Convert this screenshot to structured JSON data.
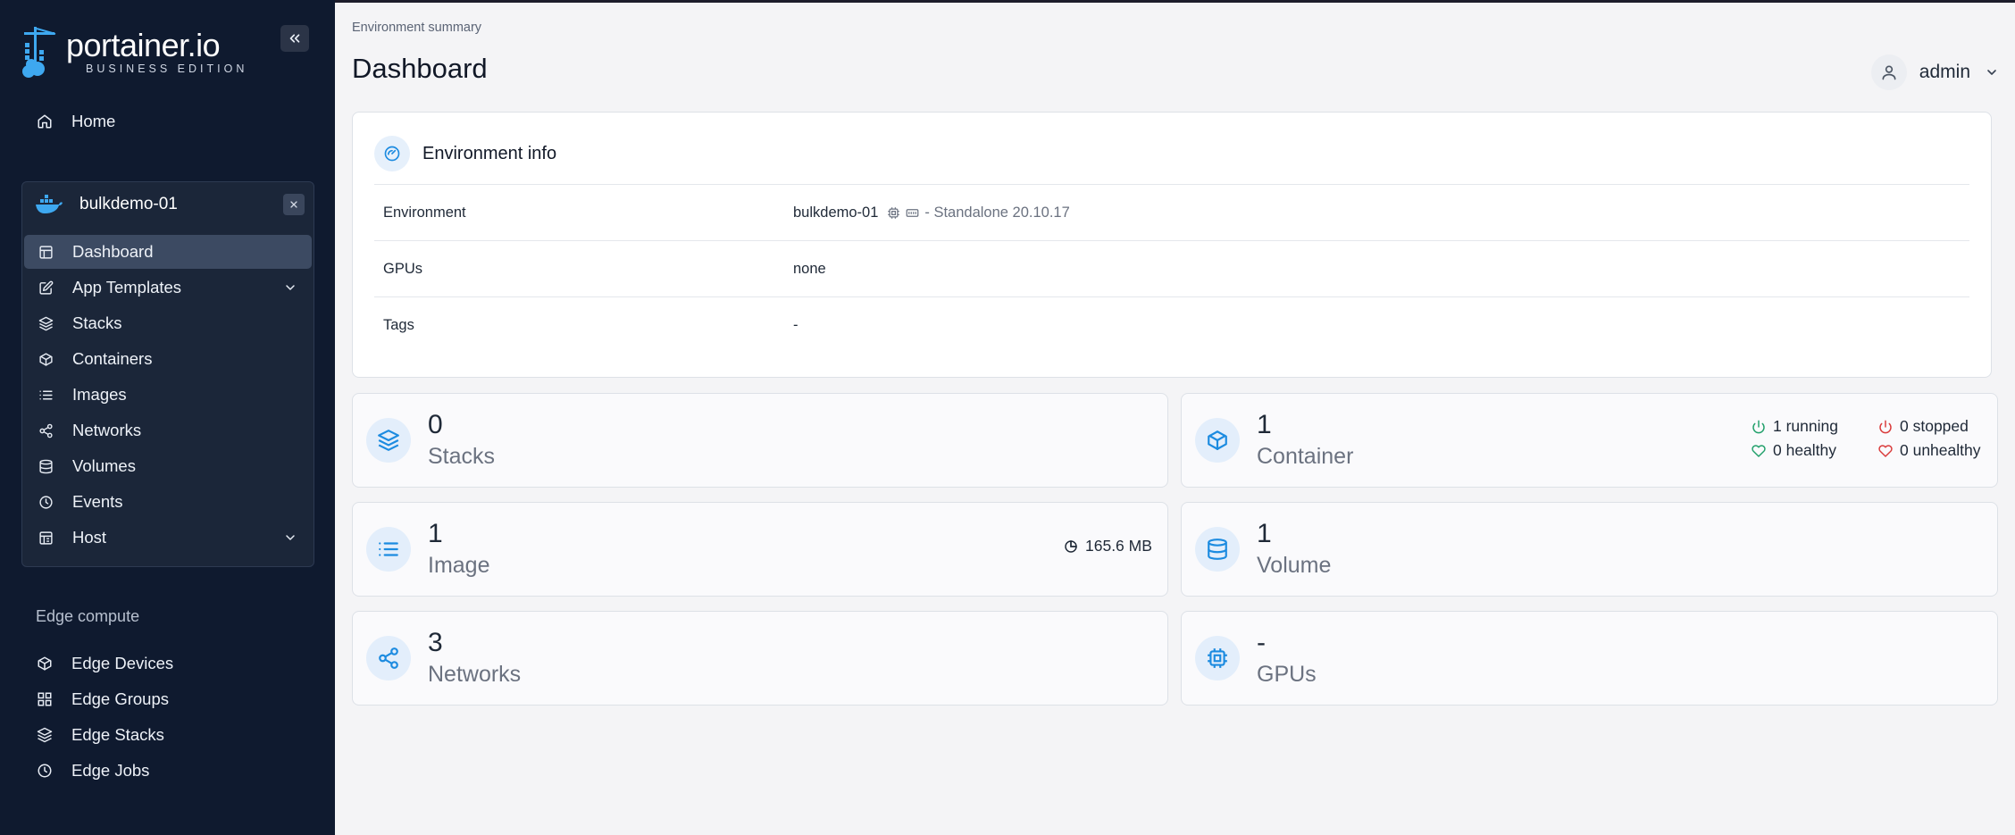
{
  "brand": {
    "name": "portainer.io",
    "edition": "BUSINESS EDITION"
  },
  "sidebar": {
    "home": "Home",
    "environment": {
      "name": "bulkdemo-01",
      "items": [
        {
          "label": "Dashboard",
          "icon": "layout-dashboard-icon"
        },
        {
          "label": "App Templates",
          "icon": "edit-icon"
        },
        {
          "label": "Stacks",
          "icon": "layers-icon"
        },
        {
          "label": "Containers",
          "icon": "box-icon"
        },
        {
          "label": "Images",
          "icon": "list-icon"
        },
        {
          "label": "Networks",
          "icon": "share-icon"
        },
        {
          "label": "Volumes",
          "icon": "database-icon"
        },
        {
          "label": "Events",
          "icon": "clock-icon"
        },
        {
          "label": "Host",
          "icon": "host-icon"
        }
      ]
    },
    "edge_section": "Edge compute",
    "edge_items": [
      {
        "label": "Edge Devices",
        "icon": "box-icon"
      },
      {
        "label": "Edge Groups",
        "icon": "grid-icon"
      },
      {
        "label": "Edge Stacks",
        "icon": "layers-icon"
      },
      {
        "label": "Edge Jobs",
        "icon": "clock-icon"
      }
    ]
  },
  "header": {
    "breadcrumb": "Environment summary",
    "title": "Dashboard",
    "user": "admin"
  },
  "env_info": {
    "title": "Environment info",
    "rows": [
      {
        "key": "Environment",
        "value": "bulkdemo-01",
        "extra": "- Standalone 20.10.17"
      },
      {
        "key": "GPUs",
        "value": "none"
      },
      {
        "key": "Tags",
        "value": "-"
      }
    ]
  },
  "stats": {
    "stacks": {
      "count": "0",
      "label": "Stacks"
    },
    "containers": {
      "count": "1",
      "label": "Container",
      "running": "1 running",
      "stopped": "0 stopped",
      "healthy": "0 healthy",
      "unhealthy": "0 unhealthy"
    },
    "images": {
      "count": "1",
      "label": "Image",
      "size": "165.6 MB"
    },
    "volumes": {
      "count": "1",
      "label": "Volume"
    },
    "networks": {
      "count": "3",
      "label": "Networks"
    },
    "gpus": {
      "count": "-",
      "label": "GPUs"
    }
  },
  "colors": {
    "sidebar_bg": "#0f1a2f",
    "accent": "#1c8be0",
    "running": "#22a06b",
    "stopped": "#d93b3b"
  }
}
